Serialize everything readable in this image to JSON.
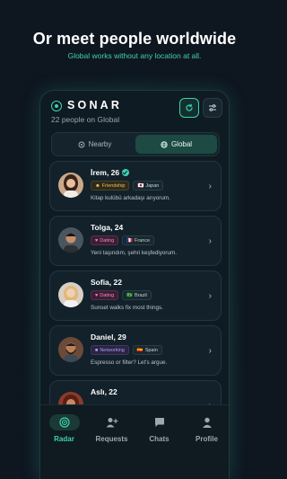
{
  "headline": "Or meet people worldwide",
  "subline": "Global works without any location at all.",
  "app": {
    "logo_text": "SONAR",
    "people_count": "22 people on Global",
    "refresh_icon": "refresh-icon",
    "filter_icon": "sliders-icon",
    "accent": "#3fd1b0"
  },
  "toggle": {
    "nearby_label": "Nearby",
    "global_label": "Global",
    "selected": "Global"
  },
  "profiles": [
    {
      "name": "İrem, 26",
      "verified": true,
      "intent": "Friendship",
      "country": "Japan",
      "flag": "🇯🇵",
      "bio": "Kitap kulübü arkadaşı arıyorum."
    },
    {
      "name": "Tolga, 24",
      "verified": false,
      "intent": "Dating",
      "country": "France",
      "flag": "🇫🇷",
      "bio": "Yeni taşındım, şehri keşfediyorum."
    },
    {
      "name": "Sofia, 22",
      "verified": false,
      "intent": "Dating",
      "country": "Brazil",
      "flag": "🇧🇷",
      "bio": "Sunset walks fix most things."
    },
    {
      "name": "Daniel, 29",
      "verified": false,
      "intent": "Networking",
      "country": "Spain",
      "flag": "🇪🇸",
      "bio": "Espresso or filter? Let's argue."
    },
    {
      "name": "Aslı, 22",
      "verified": false,
      "intent": "",
      "country": "",
      "flag": "",
      "bio": ""
    }
  ],
  "nav": {
    "radar": "Radar",
    "requests": "Requests",
    "chats": "Chats",
    "profile": "Profile",
    "active": "Radar"
  }
}
